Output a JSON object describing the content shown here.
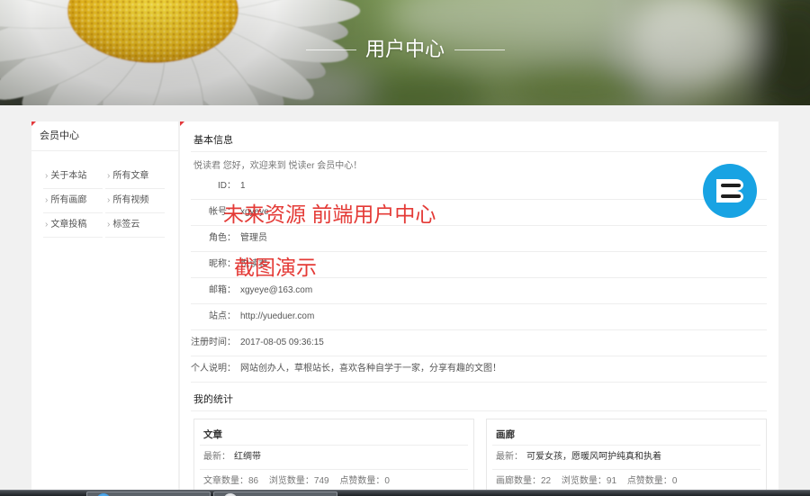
{
  "colors": {
    "accent": "#e4393c",
    "avatar": "#18a3e3",
    "watermark": "#e3302c"
  },
  "banner": {
    "title": "用户中心"
  },
  "sidebar": {
    "title": "会员中心",
    "bullet": "›",
    "links": [
      {
        "label": "关于本站"
      },
      {
        "label": "所有文章"
      },
      {
        "label": "所有画廊"
      },
      {
        "label": "所有视频"
      },
      {
        "label": "文章投稿"
      },
      {
        "label": "标签云"
      }
    ]
  },
  "profile": {
    "title": "基本信息",
    "greeting": "悦读君 您好，欢迎来到 悦读er 会员中心！",
    "fields": [
      {
        "label": "ID：",
        "value": "1"
      },
      {
        "label": "帐号：",
        "value": "xgyeye"
      },
      {
        "label": "角色：",
        "value": "管理员"
      },
      {
        "label": "昵称：",
        "value": "悦读君"
      },
      {
        "label": "邮箱：",
        "value": "xgyeye@163.com"
      },
      {
        "label": "站点：",
        "value": "http://yueduer.com"
      },
      {
        "label": "注册时间：",
        "value": "2017-08-05 09:36:15"
      },
      {
        "label": "个人说明：",
        "value": "网站创办人，草根站长，喜欢各种自学于一家，分享有趣的文图！"
      }
    ]
  },
  "stats": {
    "title": "我的统计",
    "boxes": [
      {
        "title": "文章",
        "latest_label": "最新：",
        "latest_value": "红绸带",
        "metrics": [
          {
            "label": "文章数量：",
            "value": "86"
          },
          {
            "label": "浏览数量：",
            "value": "749"
          },
          {
            "label": "点赞数量：",
            "value": "0"
          }
        ]
      },
      {
        "title": "画廊",
        "latest_label": "最新：",
        "latest_value": "可爱女孩，愿暖风呵护纯真和执着",
        "metrics": [
          {
            "label": "画廊数量：",
            "value": "22"
          },
          {
            "label": "浏览数量：",
            "value": "91"
          },
          {
            "label": "点赞数量：",
            "value": "0"
          }
        ]
      }
    ]
  },
  "watermark": {
    "line1": "未来资源 前端用户中心",
    "line2": "截图演示"
  }
}
